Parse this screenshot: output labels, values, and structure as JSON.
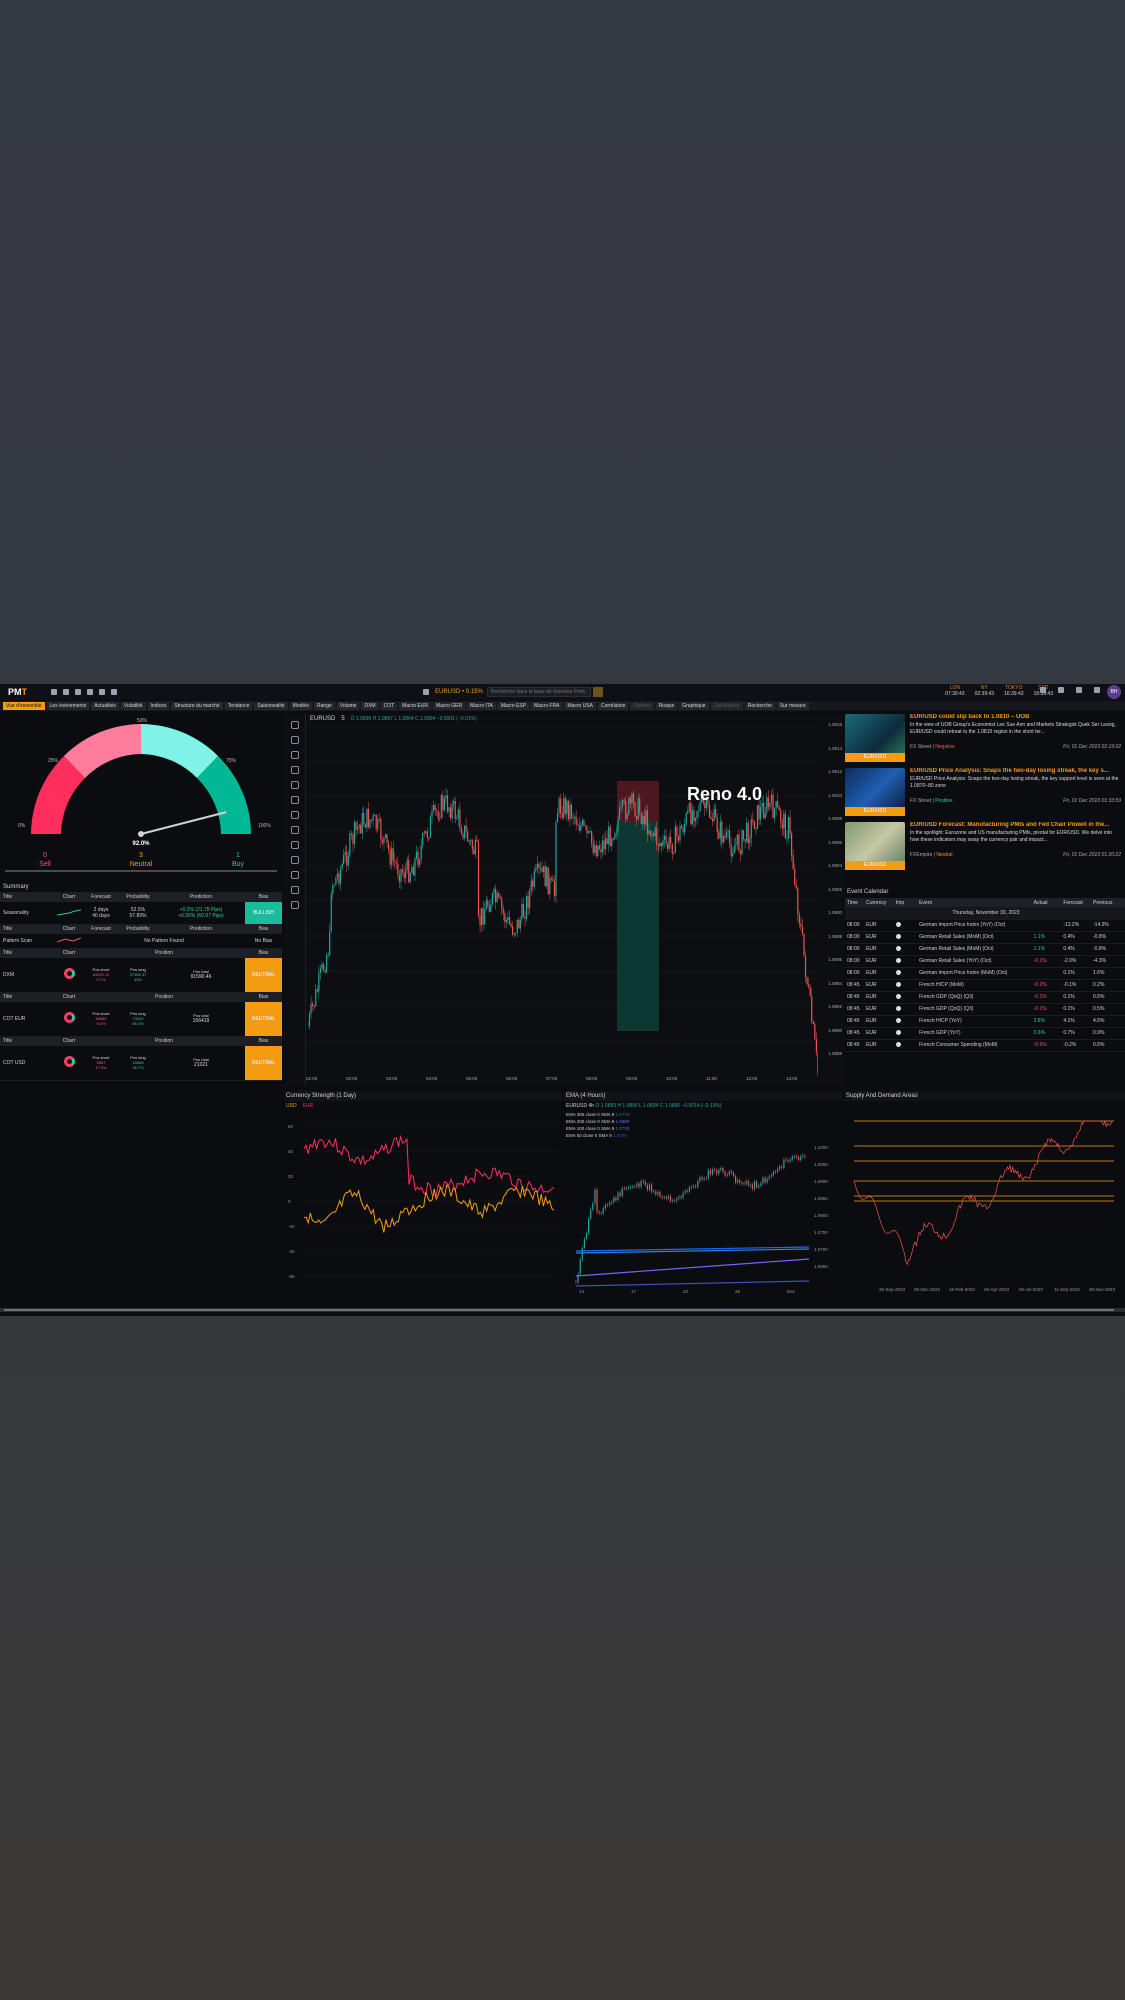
{
  "app": {
    "logo_main": "PM",
    "logo_accent": "T",
    "pair": "EURUSD • 0.15%",
    "search_placeholder": "Recherche dans la base de données Prem"
  },
  "clocks": [
    {
      "city": "LON",
      "time": "07:39:43"
    },
    {
      "city": "NY",
      "time": "02:39:43"
    },
    {
      "city": "TOKYO",
      "time": "16:39:43"
    },
    {
      "city": "SYD",
      "time": "18:39:43"
    }
  ],
  "avatar": "BH",
  "nav": [
    "Vue d'ensemble",
    "Les événements",
    "Actualités",
    "Volatilité",
    "Indices",
    "Structure du marché",
    "Tendance",
    "Saisonnalité",
    "Modèle",
    "Range",
    "Volume",
    "DXM",
    "COT",
    "Macro EUR",
    "Macro GER",
    "Macro ITA",
    "Macro ESP",
    "Macro FRA",
    "Macro USA",
    "Corrélation",
    "Options",
    "Risque",
    "Graphique",
    "Calculatrice",
    "Recherche",
    "Sur mesure"
  ],
  "gauge": {
    "value_label": "92.0%",
    "value": 0.92,
    "ticks": [
      "0%",
      "25%",
      "50%",
      "75%",
      "100%"
    ],
    "sell_count": "0",
    "sell_label": "Sell",
    "neutral_count": "3",
    "neutral_label": "Neutral",
    "buy_count": "1",
    "buy_label": "Buy"
  },
  "summary": {
    "title": "Summary",
    "h1": [
      "Title",
      "Chart",
      "Forecast",
      "Probability",
      "Prediction",
      "Bias"
    ],
    "seasonality": {
      "title": "Seasonality",
      "f1": "2 days",
      "p1": "52.5%",
      "pr1": "+0.2% (21.78 Pips)",
      "f2": "40 days",
      "p2": "57.89%",
      "pr2": "+0.56% (60.97 Pips)",
      "bias": "BULLISH"
    },
    "h2": [
      "Title",
      "Chart",
      "Forecast",
      "Probability",
      "Prediction",
      "Bias"
    ],
    "pattern": {
      "title": "Pattern Scan",
      "prediction": "No Pattern Found",
      "bias": "No Bias"
    },
    "h3": [
      "Title",
      "Chart",
      "Position",
      "Bias"
    ],
    "pos_heads": [
      "Pos short",
      "Pos long",
      "Pos total"
    ],
    "dxm": {
      "title": "DXM",
      "short": "54220.12",
      "short_pct": "0.7%",
      "long": "37365.37",
      "long_pct": "30%",
      "total": "91590.46",
      "bias": "NEUTRAL"
    },
    "h4": [
      "Title",
      "Chart",
      "Position",
      "Bias"
    ],
    "coteur": {
      "title": "COT EUR",
      "short": "83689",
      "short_pct": "9.2%",
      "long": "73030",
      "long_pct": "55.3%",
      "total": "156419",
      "bias": "NEUTRAL"
    },
    "h5": [
      "Title",
      "Chart",
      "Position",
      "Bias"
    ],
    "cotusd": {
      "title": "COT USD",
      "short": "5667",
      "short_pct": "17.9%",
      "long": "15666",
      "long_pct": "38.7%",
      "total": "21021",
      "bias": "NEUTRAL"
    }
  },
  "main_chart": {
    "symbol": "EURUSD",
    "interval": "5",
    "ohlc": "O 1.0895 H 1.0897 L 1.0894 C 1.0894 −0.0001 (−0.01%)",
    "watermark": "Reno 4.0",
    "price_ticks": [
      "1.0916",
      "1.0914",
      "1.0912",
      "1.0910",
      "1.0908",
      "1.0906",
      "1.0904",
      "1.0902",
      "1.0900",
      "1.0898",
      "1.0896",
      "1.0894",
      "1.0892",
      "1.0890",
      "1.0888"
    ],
    "time_ticks": [
      "01:00",
      "02:00",
      "03:00",
      "04:00",
      "05:00",
      "06:00",
      "07:00",
      "08:00",
      "09:00",
      "10:00",
      "11:00",
      "12:00",
      "13:00"
    ]
  },
  "news": [
    {
      "title": "EUR/USD could slip back to 1.0810 – UOB",
      "summary": "In the view of UOB Group's Economist Lee Sue Ann and Markets Strategist Quek Ser Leang, EUR/USD could retreat to the 1.0810 region in the short ter...",
      "source": "FX Street",
      "sentiment": "Negative",
      "date": "Fri, 01 Dec 2023 02:19:02",
      "tag": "EUR/USD"
    },
    {
      "title": "EUR/USD Price Analysis: Snaps the two-day losing streak, the key s...",
      "summary": "EUR/USD Price Analysis: Snaps the two-day losing streak, the key support level is seen at the 1.0870–80 zone",
      "source": "FX Street",
      "sentiment": "Positive",
      "date": "Fri, 01 Dec 2023 01:33:59",
      "tag": "EUR/USD"
    },
    {
      "title": "EUR/USD Forecast: Manufacturing PMIs and Fed Chair Powell in the...",
      "summary": "In the spotlight: Eurozone and US manufacturing PMIs, pivotal for EUR/USD. We delve into how these indicators may sway the currency pair and impact...",
      "source": "FXEmpire",
      "sentiment": "Neutral",
      "date": "Fri, 01 Dec 2023 01:20:22",
      "tag": "EUR/USD"
    }
  ],
  "calendar": {
    "title": "Event Calendar",
    "headers": [
      "Time",
      "Currency",
      "Imp",
      "Event",
      "Actual",
      "Forecast",
      "Previous"
    ],
    "date": "Thursday, November 30, 2023",
    "rows": [
      {
        "time": "08:00",
        "cur": "EUR",
        "event": "German Import Price Index (YoY) (Oct)",
        "actual": "",
        "forecast": "-13.2%",
        "previous": "-14.3%"
      },
      {
        "time": "08:00",
        "cur": "EUR",
        "event": "German Retail Sales (MoM) (Oct)",
        "actual": "1.1%",
        "forecast": "0.4%",
        "previous": "-0.8%"
      },
      {
        "time": "08:00",
        "cur": "EUR",
        "event": "German Retail Sales (MoM) (Oct)",
        "actual": "1.1%",
        "forecast": "0.4%",
        "previous": "-0.8%"
      },
      {
        "time": "08:00",
        "cur": "EUR",
        "event": "German Retail Sales (YoY) (Oct)",
        "actual": "-0.1%",
        "forecast": "-2.0%",
        "previous": "-4.3%"
      },
      {
        "time": "08:00",
        "cur": "EUR",
        "event": "German Import Price Index (MoM) (Oct)",
        "actual": "",
        "forecast": "0.1%",
        "previous": "1.6%"
      },
      {
        "time": "08:45",
        "cur": "EUR",
        "event": "French HICP (MoM)",
        "actual": "-0.2%",
        "forecast": "-0.1%",
        "previous": "0.2%"
      },
      {
        "time": "08:45",
        "cur": "EUR",
        "event": "French GDP (QoQ) (Q3)",
        "actual": "-0.1%",
        "forecast": "0.1%",
        "previous": "0.5%"
      },
      {
        "time": "08:45",
        "cur": "EUR",
        "event": "French GDP (QoQ) (Q3)",
        "actual": "-0.1%",
        "forecast": "0.1%",
        "previous": "0.5%"
      },
      {
        "time": "08:45",
        "cur": "EUR",
        "event": "French HICP (YoY)",
        "actual": "3.8%",
        "forecast": "4.1%",
        "previous": "4.5%"
      },
      {
        "time": "08:45",
        "cur": "EUR",
        "event": "French GDP (YoY)",
        "actual": "0.6%",
        "forecast": "0.7%",
        "previous": "0.9%"
      },
      {
        "time": "08:45",
        "cur": "EUR",
        "event": "French Consumer Spending (MoM)",
        "actual": "-0.9%",
        "forecast": "-0.2%",
        "previous": "0.5%"
      }
    ]
  },
  "currency_strength": {
    "title": "Currency Strength (1 Day)",
    "usd": "USD",
    "eur": "EUR",
    "y_ticks": [
      "60",
      "40",
      "20",
      "0",
      "-20",
      "-40",
      "-60"
    ]
  },
  "ema": {
    "title": "EMA (4 Hours)",
    "symbol": "EURUSD",
    "interval": "4h",
    "ohlc": "O 1.0893 H 1.0895 L 1.0894 C 1.0896 −0.0014 (−0.13%)",
    "lines": [
      {
        "label": "EMA 365 close 0 SMA 9",
        "value": "1.0774"
      },
      {
        "label": "EMA 200 close 0 SMA 9",
        "value": "1.0680"
      },
      {
        "label": "EMA 100 close 0 SMA 9",
        "value": "1.0730"
      },
      {
        "label": "EMA 50 close 0 SMA 9",
        "value": "1.0790"
      }
    ],
    "x_ticks": [
      "14",
      "17",
      "22",
      "26",
      "Dec"
    ],
    "y_ticks": [
      "1.1000",
      "1.0950",
      "1.0900",
      "1.0850",
      "1.0800",
      "1.0750",
      "1.0700",
      "1.0650"
    ],
    "line_colors": [
      "#2962ff",
      "#7b61ff",
      "#1e88e5",
      "#3f51b5"
    ]
  },
  "supply_demand": {
    "title": "Supply And Demand Areas",
    "x_ticks": [
      "26-Sep-2023",
      "05-Dec-2022",
      "15-Feb-2023",
      "26-Apr-2023",
      "05-Jul-2023",
      "11-Sep-2023",
      "30-Nov-2023"
    ]
  },
  "colors": {
    "accent": "#f39c12",
    "bull": "#26a69a",
    "bear": "#ef5350",
    "gauge_sell": "#ff2e5c",
    "gauge_pink": "#ff7d9c",
    "gauge_cyan": "#7ff4e6",
    "gauge_buy": "#00b894"
  }
}
